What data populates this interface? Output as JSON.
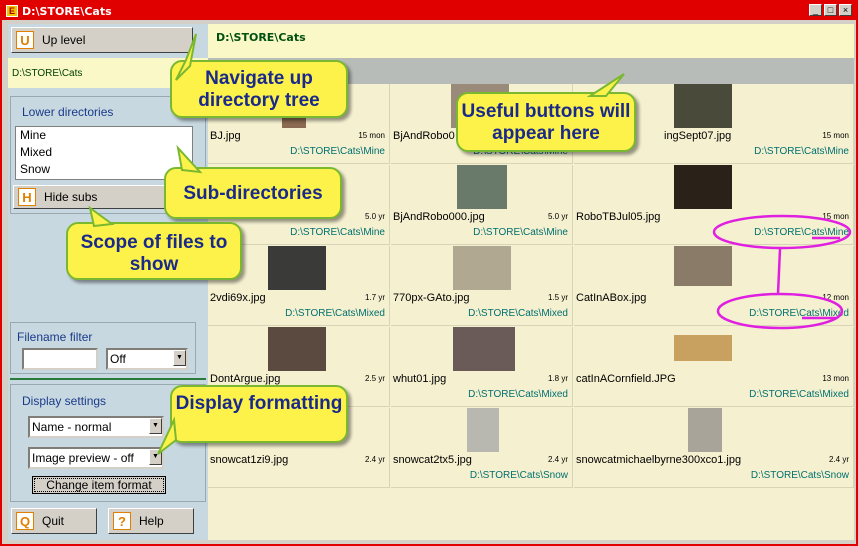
{
  "window": {
    "title": "D:\\STORE\\Cats",
    "app_icon": "E",
    "ctrl_min": "_",
    "ctrl_max": "□",
    "ctrl_close": "×"
  },
  "sidebar": {
    "up_level": {
      "hotkey": "U",
      "label": "Up level"
    },
    "current_path": "D:\\STORE\\Cats",
    "lower_dirs_label": "Lower directories",
    "dirs": [
      "Mine",
      "Mixed",
      "Snow"
    ],
    "hide_subs": {
      "hotkey": "H",
      "label": "Hide subs"
    },
    "filename_filter_label": "Filename filter",
    "filter_value": "",
    "filter_mode": "Off",
    "display_settings_label": "Display settings",
    "name_mode": "Name - normal",
    "preview_mode": "Image preview - off",
    "change_format_label": "Change item format",
    "quit": {
      "hotkey": "Q",
      "label": "Quit"
    },
    "help": {
      "hotkey": "?",
      "label": "Help"
    }
  },
  "main": {
    "header_path": "D:\\STORE\\Cats",
    "files": [
      {
        "name": "BJ.jpg",
        "age": "15 mon",
        "dir": "D:\\STORE\\Cats\\Mine",
        "thumb_color": "#8a6a50"
      },
      {
        "name": "BjAndRobo0",
        "age": "",
        "dir": "D:\\STORE\\Cats\\Mine",
        "thumb_color": "#9a8a7a"
      },
      {
        "name": "ingSept07.jpg",
        "age": "15 mon",
        "dir": "D:\\STORE\\Cats\\Mine",
        "thumb_color": "#4a4a3a"
      },
      {
        "name": "",
        "age": "5.0 yr",
        "dir": "D:\\STORE\\Cats\\Mine",
        "thumb_color": ""
      },
      {
        "name": "BjAndRobo000.jpg",
        "age": "5.0 yr",
        "dir": "D:\\STORE\\Cats\\Mine",
        "thumb_color": "#6a7a6a"
      },
      {
        "name": "RoboTBJul05.jpg",
        "age": "15 mon",
        "dir": "D:\\STORE\\Cats\\Mine",
        "thumb_color": "#2a2218"
      },
      {
        "name": "2vdi69x.jpg",
        "age": "1.7 yr",
        "dir": "D:\\STORE\\Cats\\Mixed",
        "thumb_color": "#3a3a38"
      },
      {
        "name": "770px-GAto.jpg",
        "age": "1.5 yr",
        "dir": "D:\\STORE\\Cats\\Mixed",
        "thumb_color": "#b0a890"
      },
      {
        "name": "CatInABox.jpg",
        "age": "12 mon",
        "dir": "D:\\STORE\\Cats\\Mixed",
        "thumb_color": "#8a7a68"
      },
      {
        "name": "DontArgue.jpg",
        "age": "2.5 yr",
        "dir": "",
        "thumb_color": "#5a4a40"
      },
      {
        "name": "whut01.jpg",
        "age": "1.8 yr",
        "dir": "D:\\STORE\\Cats\\Mixed",
        "thumb_color": "#6a5a58"
      },
      {
        "name": "catInACornfield.JPG",
        "age": "13 mon",
        "dir": "D:\\STORE\\Cats\\Mixed",
        "thumb_color": "#c8a060"
      },
      {
        "name": "snowcat1zi9.jpg",
        "age": "2.4 yr",
        "dir": "",
        "thumb_color": ""
      },
      {
        "name": "snowcat2tx5.jpg",
        "age": "2.4 yr",
        "dir": "D:\\STORE\\Cats\\Snow",
        "thumb_color": "#b8b8b0"
      },
      {
        "name": "snowcatmichaelbyrne300xco1.jpg",
        "age": "2.4 yr",
        "dir": "D:\\STORE\\Cats\\Snow",
        "thumb_color": "#a8a49a"
      }
    ]
  },
  "callouts": {
    "nav_up": "Navigate up directory tree",
    "useful_buttons": "Useful buttons will appear here",
    "sub_dirs": "Sub-directories",
    "scope": "Scope of files to show",
    "display": "Display formatting"
  },
  "colors": {
    "title_bar": "#e00000",
    "callout_fill": "#fdf24a",
    "callout_text": "#1a2a8a",
    "highlight": "#e020e0",
    "path_text": "#007070"
  }
}
